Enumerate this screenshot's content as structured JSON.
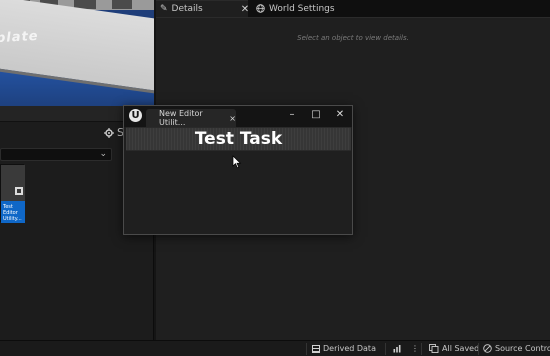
{
  "details_panel": {
    "tabs": [
      {
        "label": "Details",
        "icon": "pencil-icon",
        "active": true,
        "closable": true
      },
      {
        "label": "World Settings",
        "icon": "globe-icon",
        "active": false
      }
    ],
    "empty_hint": "Select an object to view details."
  },
  "viewport": {
    "floor_text": "plate"
  },
  "left_panel": {
    "settings_label": "S",
    "asset_label": "Test Editor Utility..."
  },
  "utility_window": {
    "tab_label": "New Editor Utilit...",
    "tab_close": "×",
    "logo": "U",
    "minimize": "–",
    "maximize": "□",
    "close": "✕",
    "task_title": "Test Task"
  },
  "status_bar": {
    "derived_data": "Derived Data",
    "all_saved": "All Saved",
    "source_control": "Source Control"
  },
  "colors": {
    "accent_blue": "#0f67c7",
    "panel_bg": "#1f1f1f",
    "titlebar_bg": "#141414"
  }
}
